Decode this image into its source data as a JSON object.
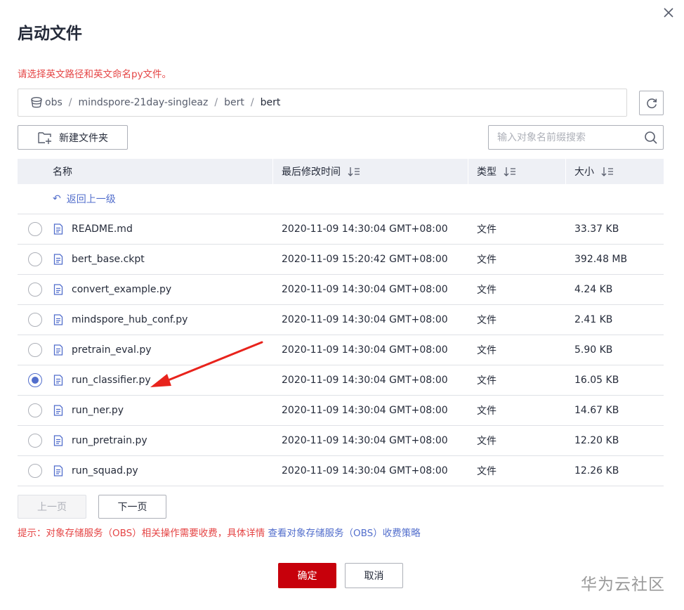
{
  "dialog": {
    "title": "启动文件",
    "hint": "请选择英文路径和英文命名py文件。"
  },
  "path": {
    "root_icon": "bucket-icon",
    "crumbs": [
      "obs",
      "mindspore-21day-singleaz",
      "bert",
      "bert"
    ],
    "separator": "/"
  },
  "toolbar": {
    "new_folder_label": "新建文件夹",
    "search_placeholder": "输入对象名前缀搜索"
  },
  "table": {
    "headers": {
      "name": "名称",
      "modified": "最后修改时间",
      "type": "类型",
      "size": "大小"
    },
    "back_label": "返回上一级",
    "rows": [
      {
        "name": "README.md",
        "modified": "2020-11-09 14:30:04 GMT+08:00",
        "type": "文件",
        "size": "33.37 KB",
        "selected": false
      },
      {
        "name": "bert_base.ckpt",
        "modified": "2020-11-09 15:20:42 GMT+08:00",
        "type": "文件",
        "size": "392.48 MB",
        "selected": false
      },
      {
        "name": "convert_example.py",
        "modified": "2020-11-09 14:30:04 GMT+08:00",
        "type": "文件",
        "size": "4.24 KB",
        "selected": false
      },
      {
        "name": "mindspore_hub_conf.py",
        "modified": "2020-11-09 14:30:04 GMT+08:00",
        "type": "文件",
        "size": "2.41 KB",
        "selected": false
      },
      {
        "name": "pretrain_eval.py",
        "modified": "2020-11-09 14:30:04 GMT+08:00",
        "type": "文件",
        "size": "5.90 KB",
        "selected": false
      },
      {
        "name": "run_classifier.py",
        "modified": "2020-11-09 14:30:04 GMT+08:00",
        "type": "文件",
        "size": "16.05 KB",
        "selected": true
      },
      {
        "name": "run_ner.py",
        "modified": "2020-11-09 14:30:04 GMT+08:00",
        "type": "文件",
        "size": "14.67 KB",
        "selected": false
      },
      {
        "name": "run_pretrain.py",
        "modified": "2020-11-09 14:30:04 GMT+08:00",
        "type": "文件",
        "size": "12.20 KB",
        "selected": false
      },
      {
        "name": "run_squad.py",
        "modified": "2020-11-09 14:30:04 GMT+08:00",
        "type": "文件",
        "size": "12.26 KB",
        "selected": false
      }
    ]
  },
  "pagination": {
    "prev_label": "上一页",
    "next_label": "下一页"
  },
  "notice": {
    "text": "提示：对象存储服务（OBS）相关操作需要收费，具体详情 ",
    "link_text": "查看对象存储服务（OBS）收费策略"
  },
  "actions": {
    "confirm_label": "确定",
    "cancel_label": "取消"
  },
  "watermark": "华为云社区",
  "colors": {
    "accent": "#526ecc",
    "primary_button": "#c7000b",
    "warning_text": "#e54545",
    "header_bg": "#eef0f5",
    "annotation": "#e8231c"
  }
}
